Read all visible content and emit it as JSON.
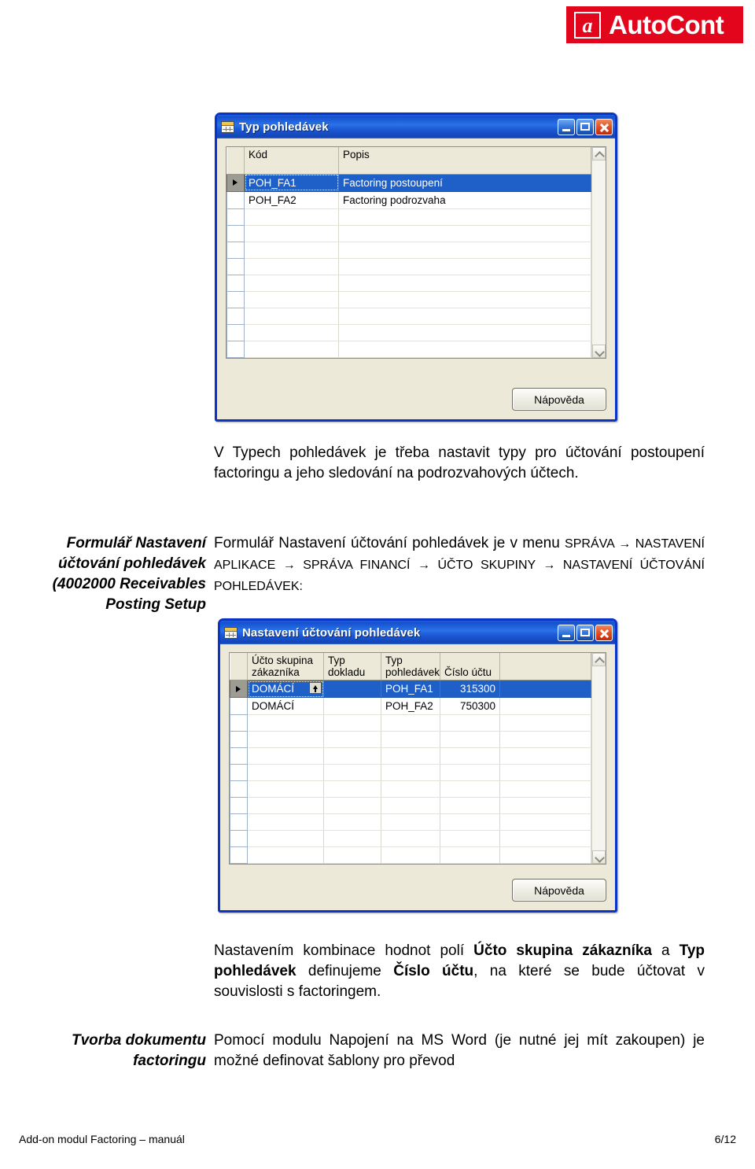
{
  "logo": {
    "mark": "a",
    "text": "AutoCont"
  },
  "window1": {
    "title": "Typ pohledávek",
    "icon": "table-icon",
    "buttons": {
      "minimize": "minimize-icon",
      "maximize": "maximize-icon",
      "close": "close-icon"
    },
    "grid": {
      "columns": [
        "Kód",
        "Popis"
      ],
      "rows": [
        {
          "selected": true,
          "cells": [
            "POH_FA1",
            "Factoring postoupení"
          ]
        },
        {
          "selected": false,
          "cells": [
            "POH_FA2",
            "Factoring podrozvaha"
          ]
        },
        {
          "selected": false,
          "cells": [
            "",
            ""
          ]
        },
        {
          "selected": false,
          "cells": [
            "",
            ""
          ]
        },
        {
          "selected": false,
          "cells": [
            "",
            ""
          ]
        },
        {
          "selected": false,
          "cells": [
            "",
            ""
          ]
        },
        {
          "selected": false,
          "cells": [
            "",
            ""
          ]
        },
        {
          "selected": false,
          "cells": [
            "",
            ""
          ]
        },
        {
          "selected": false,
          "cells": [
            "",
            ""
          ]
        },
        {
          "selected": false,
          "cells": [
            "",
            ""
          ]
        },
        {
          "selected": false,
          "cells": [
            "",
            ""
          ]
        }
      ]
    },
    "help_button": "Nápověda"
  },
  "window2": {
    "title": "Nastavení účtování pohledávek",
    "icon": "table-icon",
    "buttons": {
      "minimize": "minimize-icon",
      "maximize": "maximize-icon",
      "close": "close-icon"
    },
    "grid": {
      "columns": [
        "Účto skupina zákazníka",
        "Typ dokladu",
        "Typ pohledávek",
        "Číslo účtu"
      ],
      "rows": [
        {
          "selected": true,
          "cells": [
            "DOMÁCÍ",
            "",
            "POH_FA1",
            "315300"
          ]
        },
        {
          "selected": false,
          "cells": [
            "DOMÁCÍ",
            "",
            "POH_FA2",
            "750300"
          ]
        },
        {
          "selected": false,
          "cells": [
            "",
            "",
            "",
            ""
          ]
        },
        {
          "selected": false,
          "cells": [
            "",
            "",
            "",
            ""
          ]
        },
        {
          "selected": false,
          "cells": [
            "",
            "",
            "",
            ""
          ]
        },
        {
          "selected": false,
          "cells": [
            "",
            "",
            "",
            ""
          ]
        },
        {
          "selected": false,
          "cells": [
            "",
            "",
            "",
            ""
          ]
        },
        {
          "selected": false,
          "cells": [
            "",
            "",
            "",
            ""
          ]
        },
        {
          "selected": false,
          "cells": [
            "",
            "",
            "",
            ""
          ]
        },
        {
          "selected": false,
          "cells": [
            "",
            "",
            "",
            ""
          ]
        },
        {
          "selected": false,
          "cells": [
            "",
            "",
            "",
            ""
          ]
        }
      ]
    },
    "lookup_button": "lookup-up-arrow-icon",
    "help_button": "Nápověda"
  },
  "paragraphs": {
    "intro": "V Typech pohledávek je třeba nastavit typy pro účtování postoupení factoringu a jeho sledování na podrozvahových účtech.",
    "section1_label": "Formulář Nastavení účtování pohledávek (4002000 Receivables Posting Setup",
    "section1_text_lead": "Formulář Nastavení účtování pohledávek je v menu ",
    "section1_menu_path": "SPRÁVA → NASTAVENÍ APLIKACE → SPRÁVA FINANCÍ → ÚČTO SKUPINY → NASTAVENÍ ÚČTOVÁNÍ POHLEDÁVEK:",
    "after_window2_p1": "Nastavením kombinace hodnot polí ",
    "after_window2_b1": "Účto skupina zákazníka",
    "after_window2_p2": " a ",
    "after_window2_b2": "Typ pohledávek",
    "after_window2_p3": " definujeme ",
    "after_window2_b3": "Číslo účtu",
    "after_window2_p4": ", na které se bude účtovat v souvislosti s factoringem.",
    "section2_label": "Tvorba dokumentu factoringu",
    "section2_text": "Pomocí modulu Napojení na MS Word (je nutné jej mít zakoupen) je možné definovat šablony pro převod"
  },
  "footer": {
    "left": "Add-on modul Factoring – manuál",
    "right": "6/12"
  }
}
